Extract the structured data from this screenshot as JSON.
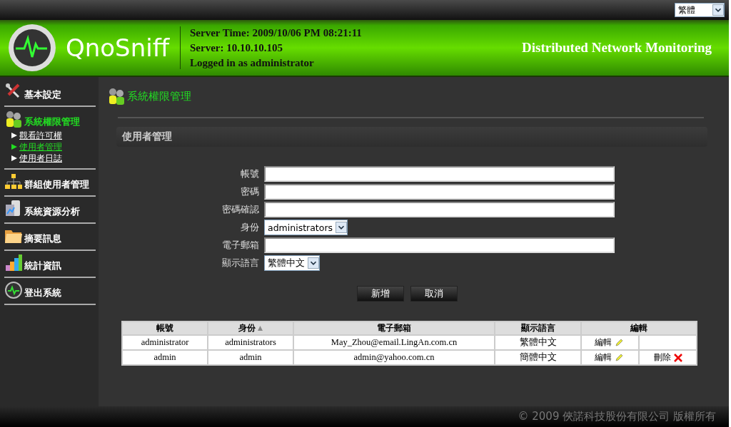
{
  "language_select": {
    "value": "繁體"
  },
  "header": {
    "logo": "QnoSniff",
    "server_time": "Server Time: 2009/10/06 PM 08:21:11",
    "server": "Server: 10.10.10.105",
    "login": "Logged in as administrator",
    "tagline": "Distributed Network Monitoring"
  },
  "sidebar": {
    "items": [
      {
        "label": "基本設定",
        "kind": "tools",
        "selected": false
      },
      {
        "label": "系統權限管理",
        "kind": "users",
        "selected": true,
        "children": [
          {
            "label": "觀看許可權",
            "selected": false
          },
          {
            "label": "使用者管理",
            "selected": true
          },
          {
            "label": "使用者日誌",
            "selected": false
          }
        ]
      },
      {
        "label": "群組使用者管理",
        "kind": "group",
        "selected": false
      },
      {
        "label": "系統資源分析",
        "kind": "server",
        "selected": false
      },
      {
        "label": "摘要訊息",
        "kind": "folder",
        "selected": false
      },
      {
        "label": "統計資訊",
        "kind": "chart",
        "selected": false
      },
      {
        "label": "登出系統",
        "kind": "logout",
        "selected": false
      }
    ]
  },
  "page_title": "系統權限管理",
  "section_title": "使用者管理",
  "form": {
    "fields": [
      {
        "label": "帳號",
        "kind": "text"
      },
      {
        "label": "密碼",
        "kind": "text"
      },
      {
        "label": "密碼確認",
        "kind": "text"
      },
      {
        "label": "身份",
        "kind": "select",
        "value": "administrators"
      },
      {
        "label": "電子郵箱",
        "kind": "text"
      },
      {
        "label": "顯示語言",
        "kind": "select",
        "value": "繁體中文"
      }
    ],
    "buttons": [
      "新增",
      "取消"
    ]
  },
  "table": {
    "columns": [
      {
        "label": "帳號",
        "sorted": false
      },
      {
        "label": "身份",
        "sorted": true
      },
      {
        "label": "電子郵箱",
        "sorted": false
      },
      {
        "label": "顯示語言",
        "sorted": false
      },
      {
        "label": "編輯",
        "sorted": false
      }
    ],
    "rows": [
      {
        "cells": [
          "administrator",
          "administrators",
          "May_Zhou@email.LingAn.com.cn",
          "繁體中文"
        ],
        "edit": "編輯"
      },
      {
        "cells": [
          "admin",
          "admin",
          "admin@yahoo.com.cn",
          "簡體中文"
        ],
        "edit": "編輯",
        "delete": "刪除"
      }
    ]
  },
  "footer": "© 2009 俠諾科技股份有限公司 版權所有"
}
